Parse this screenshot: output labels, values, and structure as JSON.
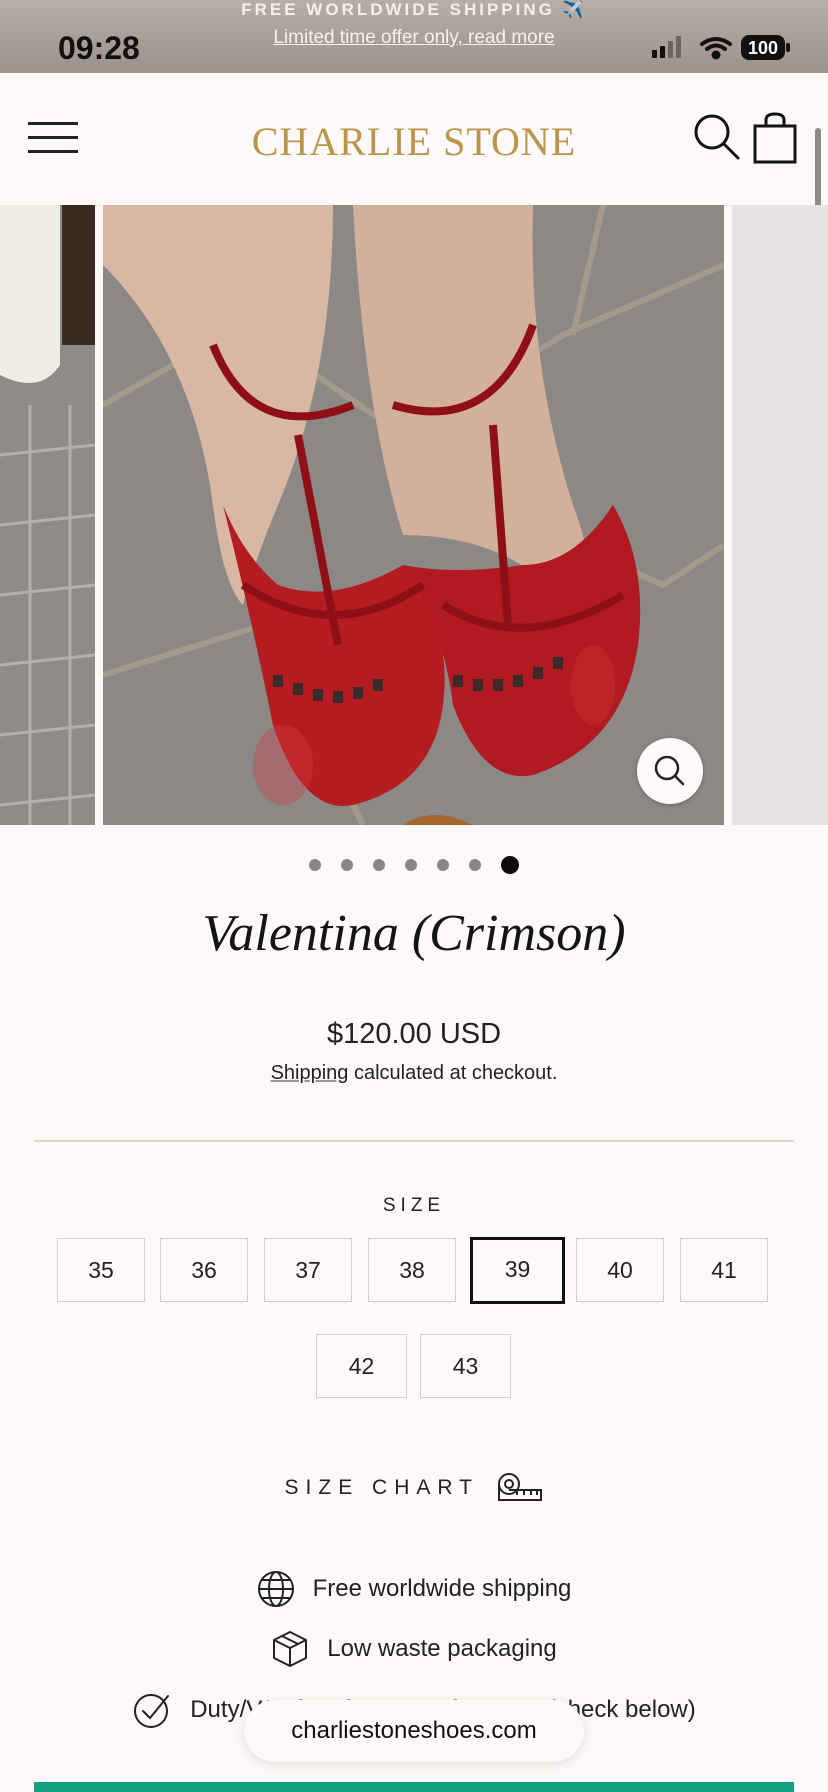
{
  "announcement": {
    "title": "FREE WORLDWIDE SHIPPING ✈️",
    "link": "Limited time offer only, read more"
  },
  "status_bar": {
    "time": "09:28",
    "battery": "100",
    "icons": [
      "signal-icon",
      "wifi-icon",
      "battery-icon"
    ]
  },
  "header": {
    "brand": "CHARLIE STONE",
    "brand_color": "#b9964a",
    "icons": [
      "menu-icon",
      "search-icon",
      "cart-icon"
    ]
  },
  "gallery": {
    "slide_count": 7,
    "active_slide": 7,
    "zoom_icon": "zoom-icon"
  },
  "product": {
    "title": "Valentina (Crimson)",
    "price": "$120.00 USD",
    "shipping_link": "Shipping",
    "shipping_rest": " calculated at checkout."
  },
  "size": {
    "label": "SIZE",
    "options": [
      "35",
      "36",
      "37",
      "38",
      "39",
      "40",
      "41",
      "42",
      "43"
    ],
    "selected": "39"
  },
  "size_chart": {
    "label": "SIZE CHART",
    "icon": "measuring-tape-icon"
  },
  "features": [
    {
      "icon": "globe-icon",
      "text": "Free worldwide shipping"
    },
    {
      "icon": "box-icon",
      "text": "Low waste packaging"
    },
    {
      "icon": "check-circle-icon",
      "text": "Duty/VAT free for most of Europe (check below)"
    }
  ],
  "browser": {
    "url": "charliestoneshoes.com"
  },
  "colors": {
    "accent_button": "#14a083",
    "background": "#fdf9f8"
  }
}
